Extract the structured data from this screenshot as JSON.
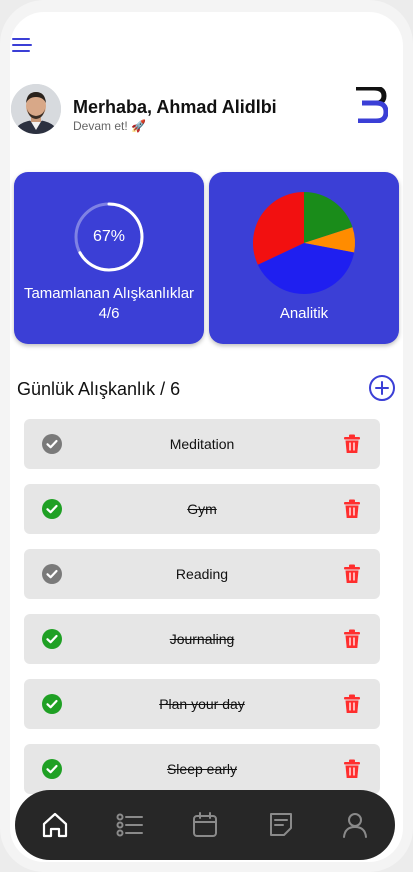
{
  "header": {
    "menu_icon": "hamburger-menu-icon",
    "greeting": "Merhaba, Ahmad Alidlbi",
    "subtitle": "Devam et! 🚀",
    "logo": "b-logo"
  },
  "cards": {
    "progress": {
      "percent_text": "67%",
      "percent_value": 67,
      "label": "Tamamlanan Alışkanlıklar",
      "count": "4/6"
    },
    "analytics": {
      "label": "Analitik",
      "slices": [
        {
          "color": "#1a8c1a",
          "value": 20
        },
        {
          "color": "#ff8c00",
          "value": 8
        },
        {
          "color": "#1f1ff0",
          "value": 40
        },
        {
          "color": "#f21010",
          "value": 32
        }
      ]
    }
  },
  "habits_section": {
    "title": "Günlük Alışkanlık / 6",
    "add_icon": "add-circle-icon"
  },
  "habits": [
    {
      "name": "Meditation",
      "done": false
    },
    {
      "name": "Gym",
      "done": true
    },
    {
      "name": "Reading",
      "done": false
    },
    {
      "name": "Journaling",
      "done": true
    },
    {
      "name": "Plan your day",
      "done": true
    },
    {
      "name": "Sleep early",
      "done": true
    }
  ],
  "colors": {
    "accent": "#3b3fd6",
    "done": "#1fa024",
    "pending": "#7a7a7a",
    "trash": "#ff2d2d",
    "tabbar": "#272727"
  },
  "tabbar": {
    "tabs": [
      {
        "icon": "home-icon",
        "active": true
      },
      {
        "icon": "list-icon",
        "active": false
      },
      {
        "icon": "calendar-icon",
        "active": false
      },
      {
        "icon": "notes-icon",
        "active": false
      },
      {
        "icon": "profile-icon",
        "active": false
      }
    ]
  }
}
